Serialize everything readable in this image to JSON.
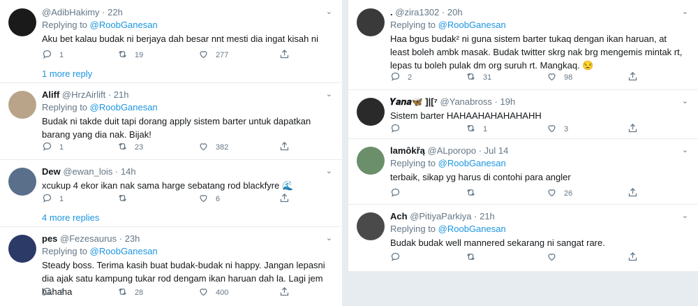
{
  "left": [
    {
      "name": "",
      "handle": "@AdibHakimy",
      "time": "22h",
      "replying_label": "Replying to",
      "replying_to": "@RoobGanesan",
      "text": "Aku bet kalau budak ni berjaya dah besar nnt mesti dia ingat kisah ni",
      "replies": "1",
      "retweets": "19",
      "likes": "277",
      "more_replies": "1 more reply",
      "avatar_color": "#1a1a1a"
    },
    {
      "name": "Aliff",
      "handle": "@HrzAirlift",
      "time": "21h",
      "replying_label": "Replying to",
      "replying_to": "@RoobGanesan",
      "text": "Budak ni takde duit tapi dorang apply sistem barter untuk dapatkan barang yang dia nak. Bijak!",
      "replies": "1",
      "retweets": "23",
      "likes": "382",
      "avatar_color": "#b9a48a"
    },
    {
      "name": "Dew",
      "handle": "@ewan_lois",
      "time": "14h",
      "text": "xcukup 4 ekor ikan nak sama harge sebatang rod blackfyre 🌊",
      "replies": "1",
      "retweets": "",
      "likes": "6",
      "more_replies": "4 more replies",
      "avatar_color": "#5a6f8a"
    },
    {
      "name": "pes",
      "handle": "@Fezesaurus",
      "time": "23h",
      "replying_label": "Replying to",
      "replying_to": "@RoobGanesan",
      "text": "Steady boss. Terima kasih buat budak-budak ni happy. Jangan lepasni dia ajak satu kampung tukar rod dengam ikan haruan dah la. Lagi jem hahaha",
      "replies": "2",
      "retweets": "28",
      "likes": "400",
      "avatar_color": "#2b3a67"
    }
  ],
  "right": [
    {
      "name": ".",
      "handle": "@zira1302",
      "time": "20h",
      "replying_label": "Replying to",
      "replying_to": "@RoobGanesan",
      "text": "Haa bgus budak² ni guna sistem barter tukaq dengan ikan haruan, at least boleh ambk masak. Budak twitter skrg nak brg mengemis mintak rt, lepas tu boleh pulak dm org suruh rt. Mangkaq. 😒",
      "replies": "2",
      "retweets": "31",
      "likes": "98",
      "avatar_color": "#3a3a3a"
    },
    {
      "name": "𝒀𝒂𝒏𝒂🦋 ]|[⁷",
      "handle": "@Yanabross",
      "time": "19h",
      "text": "Sistem barter HAHAAHAHAHAHAHH",
      "replies": "",
      "retweets": "1",
      "likes": "3",
      "avatar_color": "#2a2a2a"
    },
    {
      "name": "lamôkřą",
      "handle": "@ALporopo",
      "time": "Jul 14",
      "replying_label": "Replying to",
      "replying_to": "@RoobGanesan",
      "text": "terbaik, sikap yg harus di contohi para angler",
      "replies": "",
      "retweets": "",
      "likes": "26",
      "avatar_color": "#6b8f6a"
    },
    {
      "name": "Ach",
      "handle": "@PitiyaParkiya",
      "time": "21h",
      "replying_label": "Replying to",
      "replying_to": "@RoobGanesan",
      "text": "Budak budak well mannered sekarang ni sangat rare.",
      "replies": "",
      "retweets": "",
      "likes": "",
      "avatar_color": "#4a4a4a"
    }
  ]
}
